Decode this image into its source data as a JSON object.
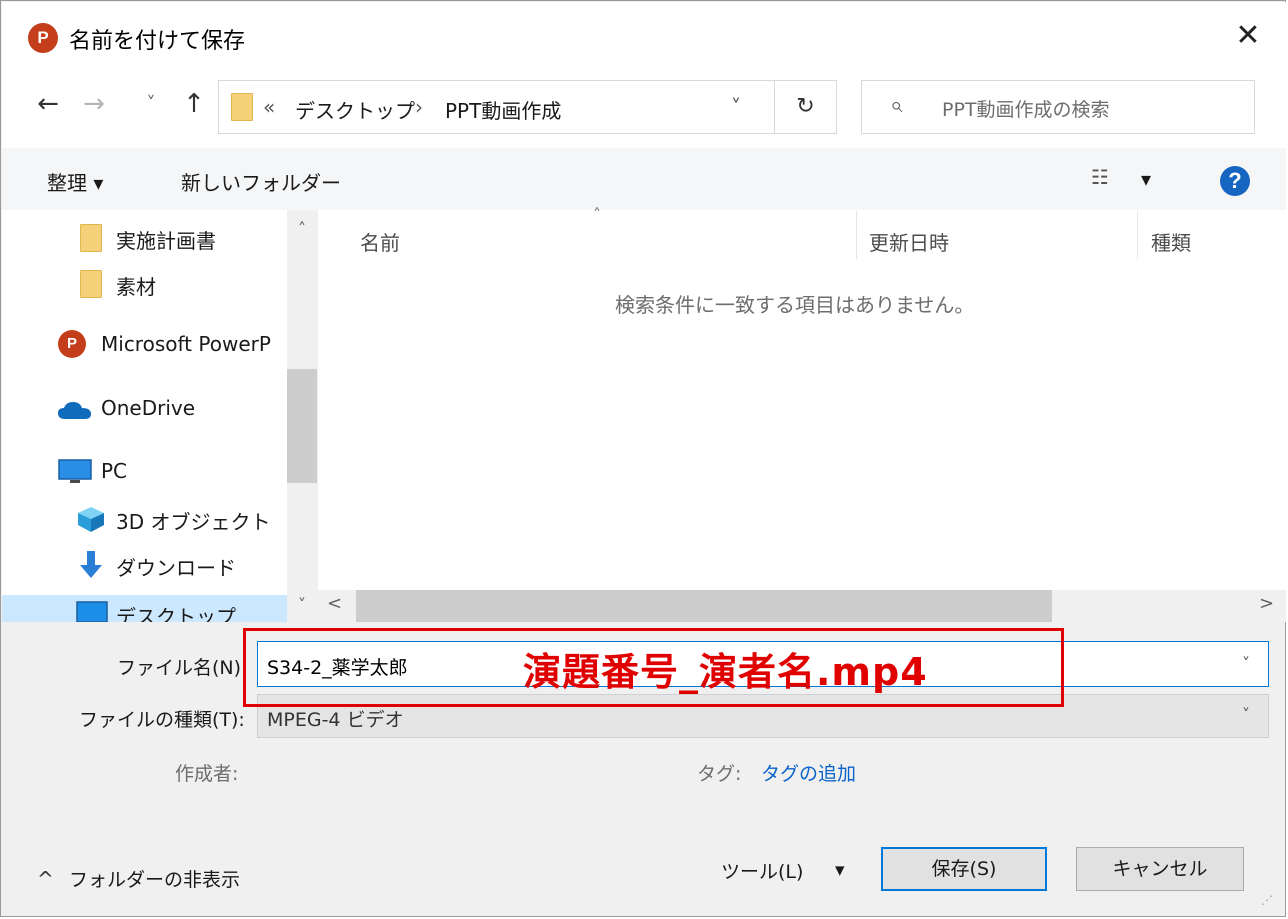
{
  "window": {
    "app_badge": "P",
    "title": "名前を付けて保存",
    "close_glyph": "✕"
  },
  "nav": {
    "back_glyph": "←",
    "forward_glyph": "→",
    "recent_glyph": "˅",
    "up_glyph": "↑",
    "address_prefix": "«",
    "breadcrumb": [
      "デスクトップ",
      "PPT動画作成"
    ],
    "breadcrumb_sep": "›",
    "dropdown_glyph": "˅",
    "refresh_glyph": "↻",
    "search_placeholder": "PPT動画作成の検索",
    "search_glyph": "⌕"
  },
  "toolbar": {
    "organize_label": "整理 ▾",
    "new_folder_label": "新しいフォルダー",
    "view_glyph": "☷",
    "view_dropdown_glyph": "▾",
    "help_glyph": "?"
  },
  "sidebar": {
    "items": [
      {
        "label": "実施計画書",
        "icon": "folder-icon"
      },
      {
        "label": "素材",
        "icon": "folder-icon"
      },
      {
        "label": "Microsoft PowerP",
        "icon": "powerpoint-icon"
      },
      {
        "label": "OneDrive",
        "icon": "cloud-icon"
      },
      {
        "label": "PC",
        "icon": "monitor-icon"
      },
      {
        "label": "3D オブジェクト",
        "icon": "cube-icon"
      },
      {
        "label": "ダウンロード",
        "icon": "download-icon"
      },
      {
        "label": "デスクトップ",
        "icon": "desktop-icon",
        "selected": true
      }
    ],
    "scroll_up_glyph": "˄",
    "scroll_down_glyph": "˅"
  },
  "filelist": {
    "sort_glyph": "˄",
    "columns": [
      "名前",
      "更新日時",
      "種類"
    ],
    "empty_message": "検索条件に一致する項目はありません。",
    "scroll_left_glyph": "<",
    "scroll_right_glyph": ">"
  },
  "form": {
    "filename_label": "ファイル名(N):",
    "filename_value": "S34-2_薬学太郎",
    "filetype_label": "ファイルの種類(T):",
    "filetype_value": "MPEG-4 ビデオ",
    "dropdown_glyph": "˅",
    "author_label": "作成者:",
    "tags_label": "タグ:",
    "tags_link": "タグの追加"
  },
  "annotation": {
    "text": "演題番号_演者名.mp4",
    "color": "#e00000"
  },
  "footer": {
    "hide_folders_glyph": "^",
    "hide_folders_label": "フォルダーの非表示",
    "tools_label": "ツール(L)",
    "tools_dropdown_glyph": "▾",
    "save_label": "保存(S)",
    "cancel_label": "キャンセル"
  }
}
